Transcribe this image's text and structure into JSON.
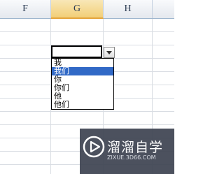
{
  "sheet": {
    "columns": [
      {
        "label": "F"
      },
      {
        "label": "G"
      },
      {
        "label": "H"
      }
    ]
  },
  "dropdown": {
    "items": [
      "我",
      "我们",
      "你",
      "你们",
      "他",
      "他们"
    ],
    "selected_index": 1
  },
  "watermark": {
    "title": "溜溜自学",
    "url": "ZIXUE.3D66.COM"
  }
}
